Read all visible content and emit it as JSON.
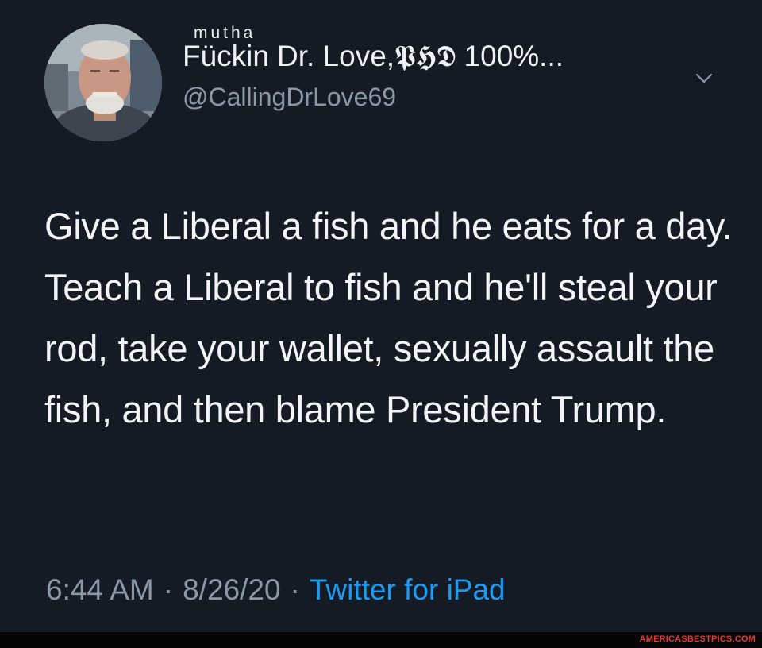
{
  "profile": {
    "name_superscript": "mutha",
    "name_prefix": "Fückin",
    "name_main": "Dr. Love,𝕻𝕳𝕯 100%...",
    "handle": "@CallingDrLove69",
    "avatar_icon": "profile-photo-avatar",
    "menu_icon": "chevron-down-icon"
  },
  "tweet": {
    "text": "Give a Liberal a fish and he eats for a day. Teach a Liberal to fish and he'll steal your rod, take your wallet, sexually assault the fish, and then blame President Trump."
  },
  "meta": {
    "time": "6:44 AM",
    "separator": "·",
    "date": "8/26/20",
    "source": "Twitter for iPad"
  },
  "watermark": {
    "text": "AMERICASBESTPICS.COM"
  },
  "colors": {
    "background": "#141b25",
    "text": "#f2f4f6",
    "secondary_text": "#8b98a5",
    "link": "#1d9bf0",
    "watermark": "#e53935"
  }
}
